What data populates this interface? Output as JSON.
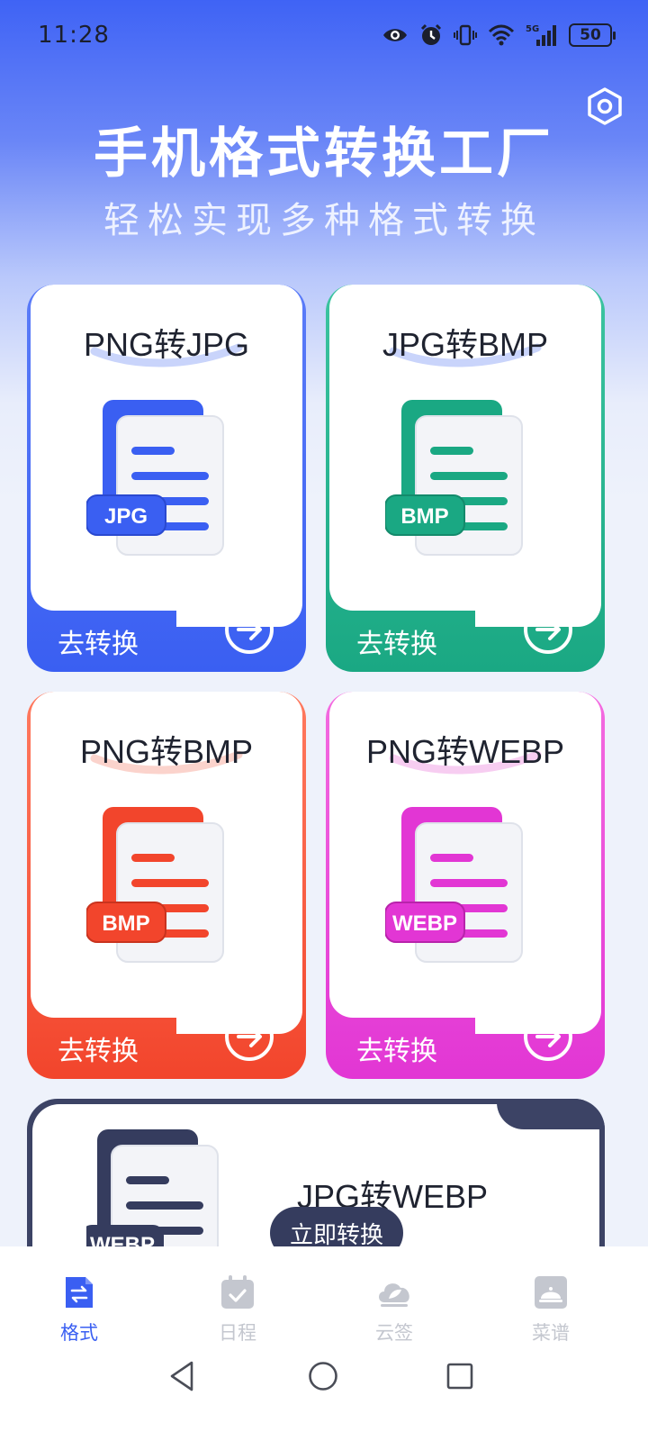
{
  "status_bar": {
    "time": "11:28",
    "battery": "50",
    "icons": [
      "eye-icon",
      "alarm-icon",
      "vibrate-icon",
      "wifi-icon",
      "signal-5g-icon",
      "battery-icon"
    ]
  },
  "header": {
    "title": "手机格式转换工厂",
    "subtitle": "轻松实现多种格式转换",
    "settings_icon": "hexagon-settings-icon"
  },
  "cards": [
    {
      "title": "PNG转JPG",
      "badge": "JPG",
      "action": "去转换",
      "color": "#3a5ff2"
    },
    {
      "title": "JPG转BMP",
      "badge": "BMP",
      "action": "去转换",
      "color": "#1aa883"
    },
    {
      "title": "PNG转BMP",
      "badge": "BMP",
      "action": "去转换",
      "color": "#f2452c"
    },
    {
      "title": "PNG转WEBP",
      "badge": "WEBP",
      "action": "去转换",
      "color": "#e236d4"
    }
  ],
  "wide_card": {
    "title": "JPG转WEBP",
    "badge": "WEBP",
    "button": "立即转换",
    "color": "#353c5e"
  },
  "bottom_nav": {
    "active": "格式",
    "items": [
      {
        "label": "格式",
        "icon": "format-icon"
      },
      {
        "label": "日程",
        "icon": "calendar-icon"
      },
      {
        "label": "云签",
        "icon": "cloud-leaf-icon"
      },
      {
        "label": "菜谱",
        "icon": "recipe-cloche-icon"
      }
    ]
  },
  "system_nav": [
    "back-icon",
    "home-icon",
    "recents-icon"
  ]
}
